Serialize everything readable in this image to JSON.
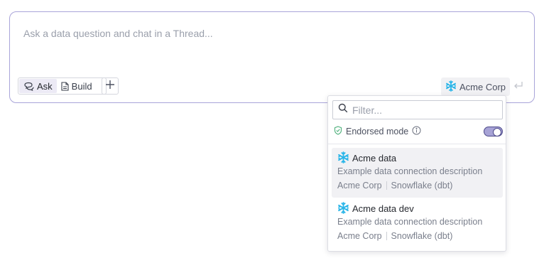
{
  "composer": {
    "placeholder": "Ask a data question and chat in a Thread...",
    "modes": [
      {
        "label": "Ask",
        "icon": "chat-bubbles-icon",
        "active": true
      },
      {
        "label": "Build",
        "icon": "document-icon",
        "active": false
      }
    ],
    "add_icon": "plus-icon",
    "connection_label": "Acme Corp",
    "connection_icon": "snowflake-icon",
    "send_icon": "enter-arrow-icon"
  },
  "dropdown": {
    "filter_placeholder": "Filter...",
    "endorsed_label": "Endorsed mode",
    "endorsed_enabled": true,
    "items": [
      {
        "name": "Acme data",
        "description": "Example data connection description",
        "org": "Acme Corp",
        "type": "Snowflake (dbt)"
      },
      {
        "name": "Acme data dev",
        "description": "Example data connection description",
        "org": "Acme Corp",
        "type": "Snowflake (dbt)"
      }
    ]
  },
  "colors": {
    "accent": "#a9a4d9",
    "toggle_on": "#a7a3d6",
    "snowflake": "#29b5e8",
    "endorsed_check": "#4caf7a"
  }
}
